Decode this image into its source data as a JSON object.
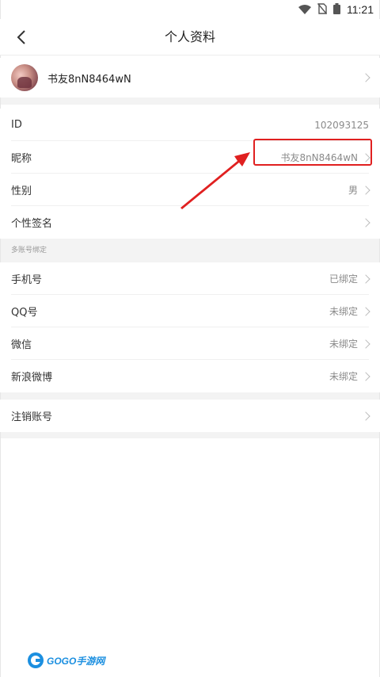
{
  "status_bar": {
    "time": "11:21"
  },
  "nav": {
    "title": "个人资料"
  },
  "profile": {
    "name": "书友8nN8464wN"
  },
  "rows": [
    {
      "label": "ID",
      "value": "102093125"
    },
    {
      "label": "昵称",
      "value": "书友8nN8464wN"
    },
    {
      "label": "性别",
      "value": "男"
    },
    {
      "label": "个性签名",
      "value": ""
    }
  ],
  "binding_section": {
    "header": "多账号绑定",
    "items": [
      {
        "label": "手机号",
        "value": "已绑定"
      },
      {
        "label": "QQ号",
        "value": "未绑定"
      },
      {
        "label": "微信",
        "value": "未绑定"
      },
      {
        "label": "新浪微博",
        "value": "未绑定"
      }
    ]
  },
  "cancel_account": {
    "label": "注销账号"
  },
  "watermark": {
    "text": "GOGO手游网"
  },
  "colors": {
    "highlight": "#e02020",
    "divider_bg": "#f3f3f3"
  }
}
